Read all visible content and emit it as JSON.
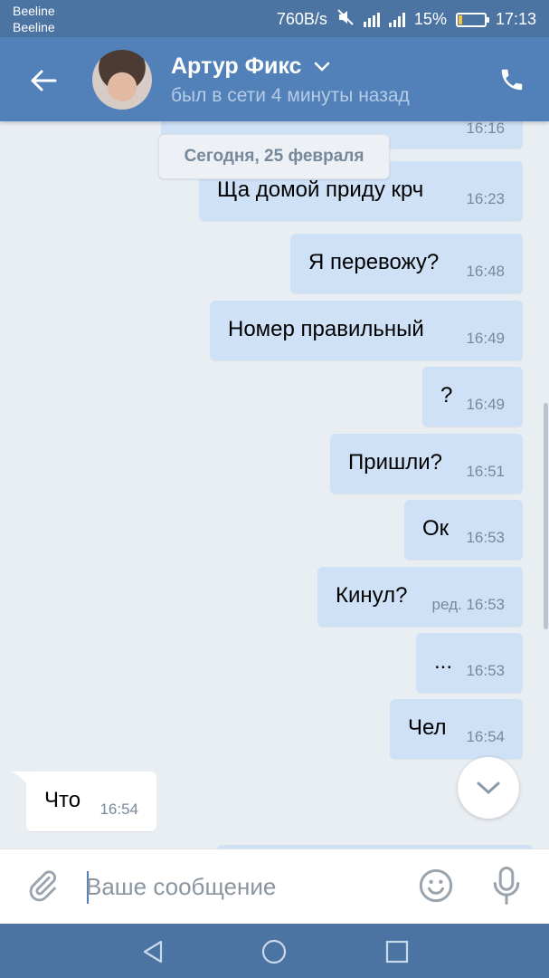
{
  "status_bar": {
    "carrier_1": "Beeline",
    "carrier_2": "Beeline",
    "network_speed": "760B/s",
    "battery_percent": "15%",
    "battery_level": 0.15,
    "time": "17:13",
    "icons": [
      "mute-icon",
      "wifi-icon",
      "signal-icon",
      "battery-icon"
    ]
  },
  "header": {
    "contact_name": "Артур Фикс",
    "last_seen": "был в сети 4 минуты назад",
    "icons": [
      "back-arrow-icon",
      "chevron-down-icon",
      "phone-icon"
    ]
  },
  "chat": {
    "previous_time": "16:16",
    "date_separator": "Сегодня, 25 февраля",
    "messages": [
      {
        "side": "out",
        "text": "Ща домой приду крч",
        "time": "16:23"
      },
      {
        "side": "out",
        "text": "Я перевожу?",
        "time": "16:48"
      },
      {
        "side": "out",
        "text": "Номер правильный",
        "time": "16:49"
      },
      {
        "side": "out",
        "text": "?",
        "time": "16:49"
      },
      {
        "side": "out",
        "text": "Пришли?",
        "time": "16:51"
      },
      {
        "side": "out",
        "text": "Ок",
        "time": "16:53"
      },
      {
        "side": "out",
        "text": "Кинул?",
        "time": "ред. 16:53"
      },
      {
        "side": "out",
        "text": "...",
        "time": "16:53"
      },
      {
        "side": "out",
        "text": "Чел",
        "time": "16:54"
      },
      {
        "side": "in",
        "text": "Что",
        "time": "16:54"
      }
    ]
  },
  "composer": {
    "placeholder": "Ваше сообщение",
    "icons": [
      "paperclip-icon",
      "emoji-icon",
      "microphone-icon"
    ]
  },
  "colors": {
    "header": "#5181b8",
    "status_bar": "#4c74a3",
    "outgoing_bubble": "#cfe1f6",
    "incoming_bubble": "#ffffff",
    "chat_background": "#e9eef3"
  }
}
